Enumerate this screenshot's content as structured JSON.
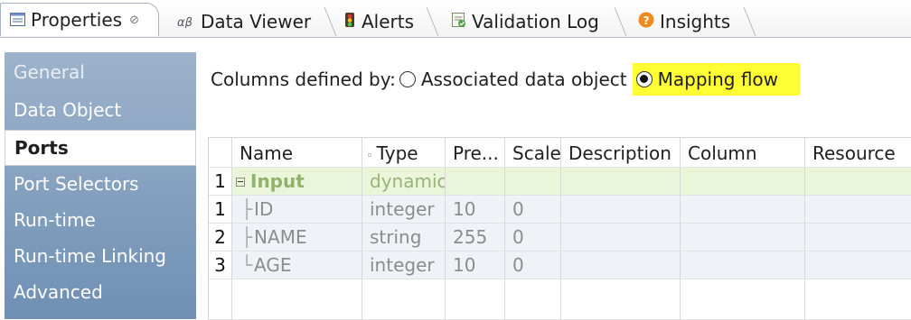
{
  "tabs": [
    {
      "label": "Properties",
      "icon": "properties-icon",
      "close": "⊘"
    },
    {
      "label": "Data Viewer",
      "icon": "data-viewer-icon"
    },
    {
      "label": "Alerts",
      "icon": "alerts-icon"
    },
    {
      "label": "Validation Log",
      "icon": "validation-log-icon"
    },
    {
      "label": "Insights",
      "icon": "insights-icon"
    }
  ],
  "sidebar": {
    "items": [
      {
        "label": "General"
      },
      {
        "label": "Data Object"
      },
      {
        "label": "Ports"
      },
      {
        "label": "Port Selectors"
      },
      {
        "label": "Run-time"
      },
      {
        "label": "Run-time Linking"
      },
      {
        "label": "Advanced"
      }
    ],
    "selected": "Ports"
  },
  "columns_defined": {
    "label": "Columns defined by:",
    "options": [
      {
        "label": "Associated data object",
        "checked": false
      },
      {
        "label": "Mapping flow",
        "checked": true
      }
    ],
    "highlight_color": "#ffff33"
  },
  "table": {
    "headers": [
      "Name",
      "Type",
      "Pre...",
      "Scale",
      "Description",
      "Column",
      "Resource"
    ],
    "rows": [
      {
        "num": "1",
        "name": "Input",
        "type": "dynamic",
        "precision": "",
        "scale": ""
      },
      {
        "num": "1",
        "name": "ID",
        "type": "integer",
        "precision": "10",
        "scale": "0"
      },
      {
        "num": "2",
        "name": "NAME",
        "type": "string",
        "precision": "255",
        "scale": "0"
      },
      {
        "num": "3",
        "name": "AGE",
        "type": "integer",
        "precision": "10",
        "scale": "0"
      }
    ]
  },
  "colors": {
    "sidebar_top": "#9db3cb",
    "sidebar_bottom": "#6f8fb3",
    "input_row": "#eaf5d9",
    "field_row": "#eff3f8"
  }
}
